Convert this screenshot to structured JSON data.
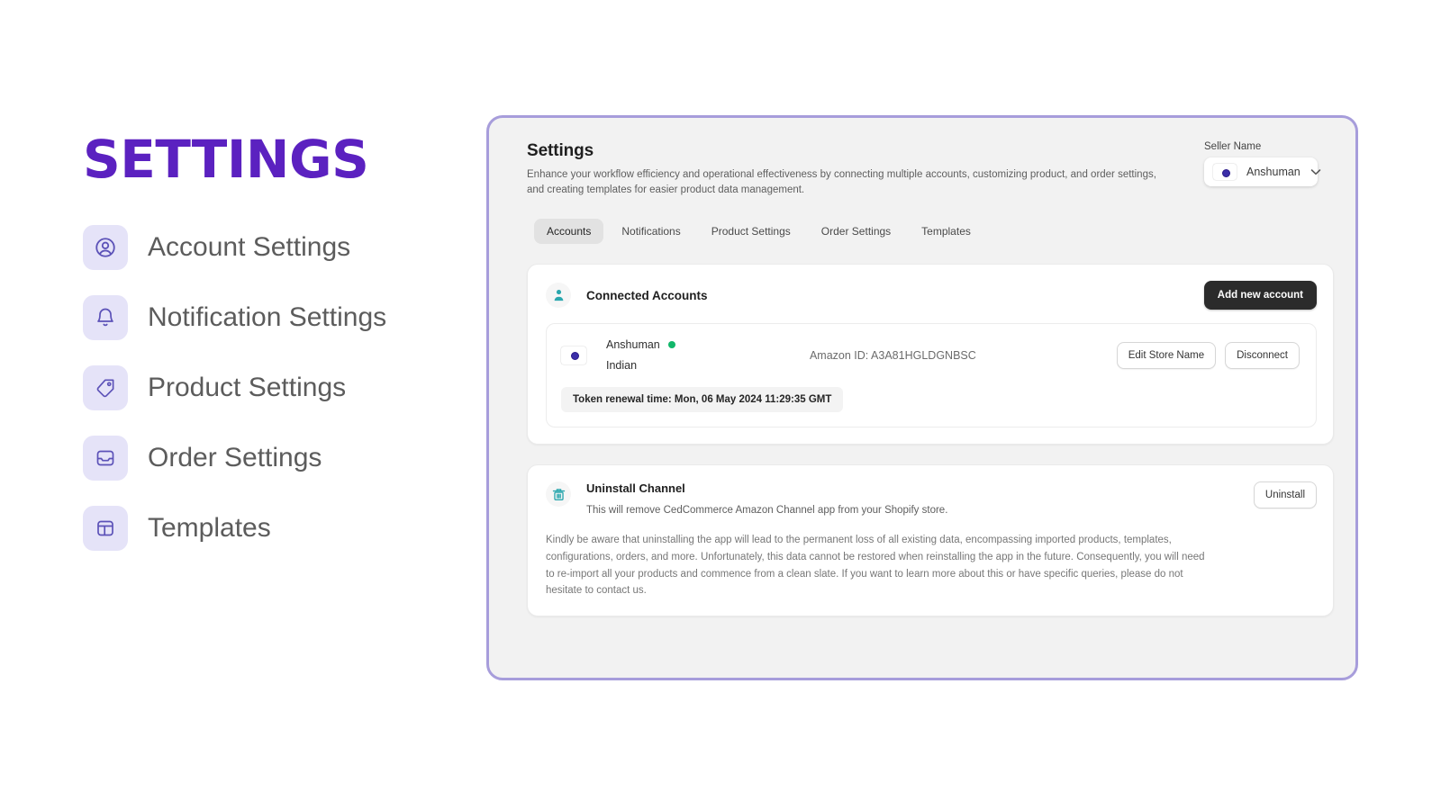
{
  "sidebar": {
    "title": "SETTINGS",
    "items": [
      {
        "label": "Account Settings",
        "icon": "user-circle-icon"
      },
      {
        "label": "Notification Settings",
        "icon": "bell-icon"
      },
      {
        "label": "Product Settings",
        "icon": "tag-icon"
      },
      {
        "label": "Order Settings",
        "icon": "inbox-icon"
      },
      {
        "label": "Templates",
        "icon": "template-icon"
      }
    ]
  },
  "panel": {
    "title": "Settings",
    "subtitle": "Enhance your workflow efficiency and operational effectiveness by connecting multiple accounts, customizing product, and order settings, and creating templates for easier product data management.",
    "seller": {
      "label": "Seller Name",
      "value": "Anshuman",
      "caret": "⌄",
      "flag": "india-flag-icon"
    },
    "tabs": [
      {
        "label": "Accounts",
        "active": true
      },
      {
        "label": "Notifications",
        "active": false
      },
      {
        "label": "Product Settings",
        "active": false
      },
      {
        "label": "Order Settings",
        "active": false
      },
      {
        "label": "Templates",
        "active": false
      }
    ]
  },
  "connected_accounts": {
    "title": "Connected Accounts",
    "icon": "person-icon",
    "add_button": "Add new account",
    "account": {
      "name": "Anshuman",
      "country": "Indian",
      "status": "online",
      "amazon_id": "Amazon ID: A3A81HGLDGNBSC",
      "edit_button": "Edit Store Name",
      "disconnect_button": "Disconnect",
      "token_renewal": "Token renewal time: Mon, 06 May 2024 11:29:35 GMT"
    }
  },
  "uninstall": {
    "title": "Uninstall Channel",
    "icon": "trash-icon",
    "button": "Uninstall",
    "line1": "This will remove CedCommerce Amazon Channel app from your Shopify store.",
    "paragraph": "Kindly be aware that uninstalling the app will lead to the permanent loss of all existing data, encompassing imported products, templates, configurations, orders, and more. Unfortunately, this data cannot be restored when reinstalling the app in the future. Consequently, you will need to re-import all your products and commence from a clean slate. If you want to learn more about this or have specific queries, please do not hesitate to contact us."
  },
  "colors": {
    "brand_purple": "#5b21c0",
    "tile_lavender": "#e5e3f8",
    "icon_indigo": "#5c52b8",
    "panel_border": "#a79ddb",
    "teal": "#2ba7ae",
    "status_green": "#12b76a"
  }
}
